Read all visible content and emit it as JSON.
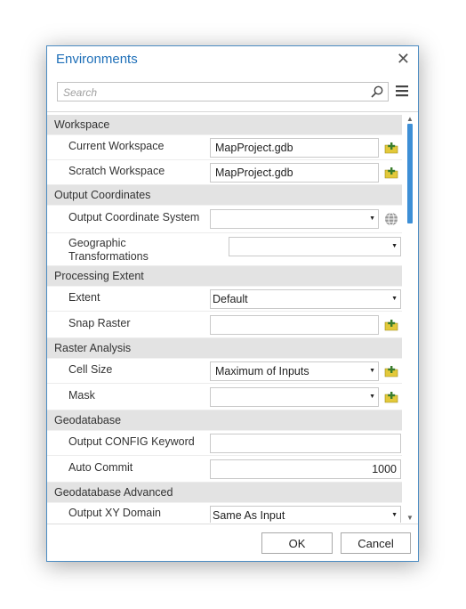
{
  "dialog": {
    "title": "Environments"
  },
  "search": {
    "placeholder": "Search"
  },
  "sections": {
    "workspace": {
      "title": "Workspace",
      "current_workspace": {
        "label": "Current Workspace",
        "value": "MapProject.gdb"
      },
      "scratch_workspace": {
        "label": "Scratch Workspace",
        "value": "MapProject.gdb"
      }
    },
    "output_coordinates": {
      "title": "Output Coordinates",
      "coordinate_system": {
        "label": "Output Coordinate System",
        "value": ""
      },
      "geo_transformations": {
        "label_line1": "Geographic",
        "label_line2": "Transformations",
        "value": ""
      }
    },
    "processing_extent": {
      "title": "Processing Extent",
      "extent": {
        "label": "Extent",
        "value": "Default"
      },
      "snap_raster": {
        "label": "Snap Raster",
        "value": ""
      }
    },
    "raster_analysis": {
      "title": "Raster Analysis",
      "cell_size": {
        "label": "Cell Size",
        "value": "Maximum of Inputs"
      },
      "mask": {
        "label": "Mask",
        "value": ""
      }
    },
    "geodatabase": {
      "title": "Geodatabase",
      "config_keyword": {
        "label": "Output CONFIG Keyword",
        "value": ""
      },
      "auto_commit": {
        "label": "Auto Commit",
        "value": "1000"
      }
    },
    "geodatabase_advanced": {
      "title": "Geodatabase Advanced",
      "xy_domain": {
        "label": "Output XY Domain",
        "value": "Same As Input"
      }
    }
  },
  "buttons": {
    "ok": "OK",
    "cancel": "Cancel"
  },
  "colors": {
    "accent": "#1e6fb8",
    "scroll_thumb": "#3d8fd6",
    "section_bg": "#e3e3e3",
    "plus_icon": "#e3c93a"
  }
}
